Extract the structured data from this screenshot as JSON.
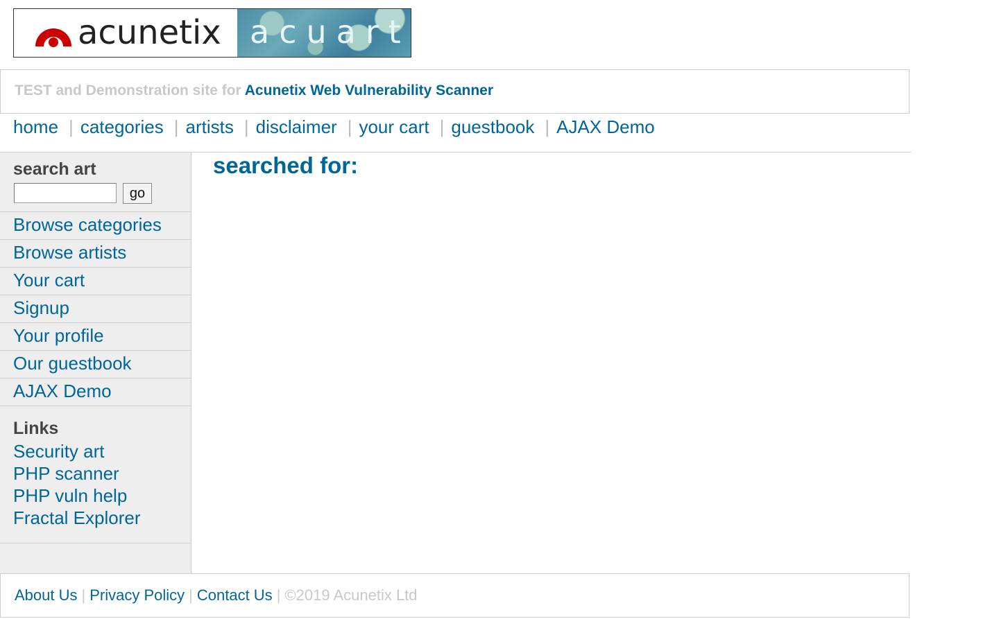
{
  "logo": {
    "left_word": "acunetix",
    "right_word": "acuart",
    "accent_color": "#cc0000"
  },
  "tagline": {
    "muted": "TEST and Demonstration site for",
    "brand": "Acunetix Web Vulnerability Scanner"
  },
  "topnav": {
    "items": [
      "home",
      "categories",
      "artists",
      "disclaimer",
      "your cart",
      "guestbook",
      "AJAX Demo"
    ],
    "separator": "|"
  },
  "sidebar": {
    "search_heading": "search art",
    "search_value": "",
    "go_label": "go",
    "menu": [
      "Browse categories",
      "Browse artists",
      "Your cart",
      "Signup",
      "Your profile",
      "Our guestbook",
      "AJAX Demo"
    ],
    "links_heading": "Links",
    "links": [
      "Security art",
      "PHP scanner",
      "PHP vuln help",
      "Fractal Explorer"
    ]
  },
  "main": {
    "heading": "searched for:"
  },
  "footer": {
    "about": "About Us",
    "privacy": "Privacy Policy",
    "contact": "Contact Us",
    "separator": "|",
    "copyright": "©2019 Acunetix Ltd"
  },
  "colors": {
    "link": "#006699",
    "muted": "#c8c8c8",
    "sidebar_bg": "#eeeeee"
  }
}
